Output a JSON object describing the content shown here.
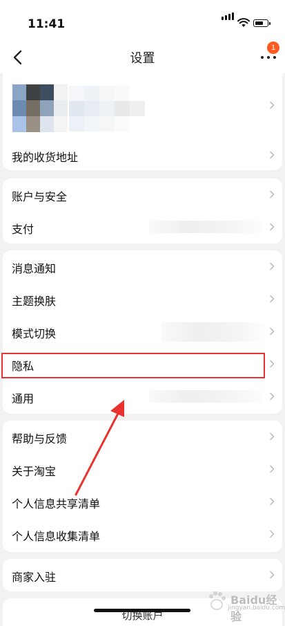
{
  "status_bar": {
    "time": "11:41"
  },
  "nav": {
    "title": "设置",
    "badge_count": "1"
  },
  "profile": {
    "avatar_colors": [
      "#8aa6c4",
      "#3e4244",
      "#3c4d5f",
      "#f2f2f2",
      "#6d8bb0",
      "#756e62",
      "#8fa4ba",
      "#e9ecf0",
      "#a9c3e8",
      "#9a9086",
      "#dfe5ee",
      "#f5f5f5"
    ]
  },
  "groups": [
    {
      "items": [
        {
          "label": "我的收货地址"
        }
      ]
    },
    {
      "items": [
        {
          "label": "账户与安全"
        },
        {
          "label": "支付"
        }
      ]
    },
    {
      "items": [
        {
          "label": "消息通知"
        },
        {
          "label": "主题换肤"
        },
        {
          "label": "模式切换"
        },
        {
          "label": "隐私"
        },
        {
          "label": "通用"
        }
      ]
    },
    {
      "items": [
        {
          "label": "帮助与反馈"
        },
        {
          "label": "关于淘宝"
        },
        {
          "label": "个人信息共享清单"
        },
        {
          "label": "个人信息收集清单"
        }
      ]
    },
    {
      "items": [
        {
          "label": "商家入驻"
        }
      ]
    }
  ],
  "bottom": {
    "label": "切换账户"
  },
  "watermark": {
    "text": "Baidu经验",
    "sub": "jingyan.baidu.com"
  },
  "colors": {
    "highlight": "#e8322f",
    "badge": "#ff5a1f",
    "background": "#f2f2f2"
  }
}
